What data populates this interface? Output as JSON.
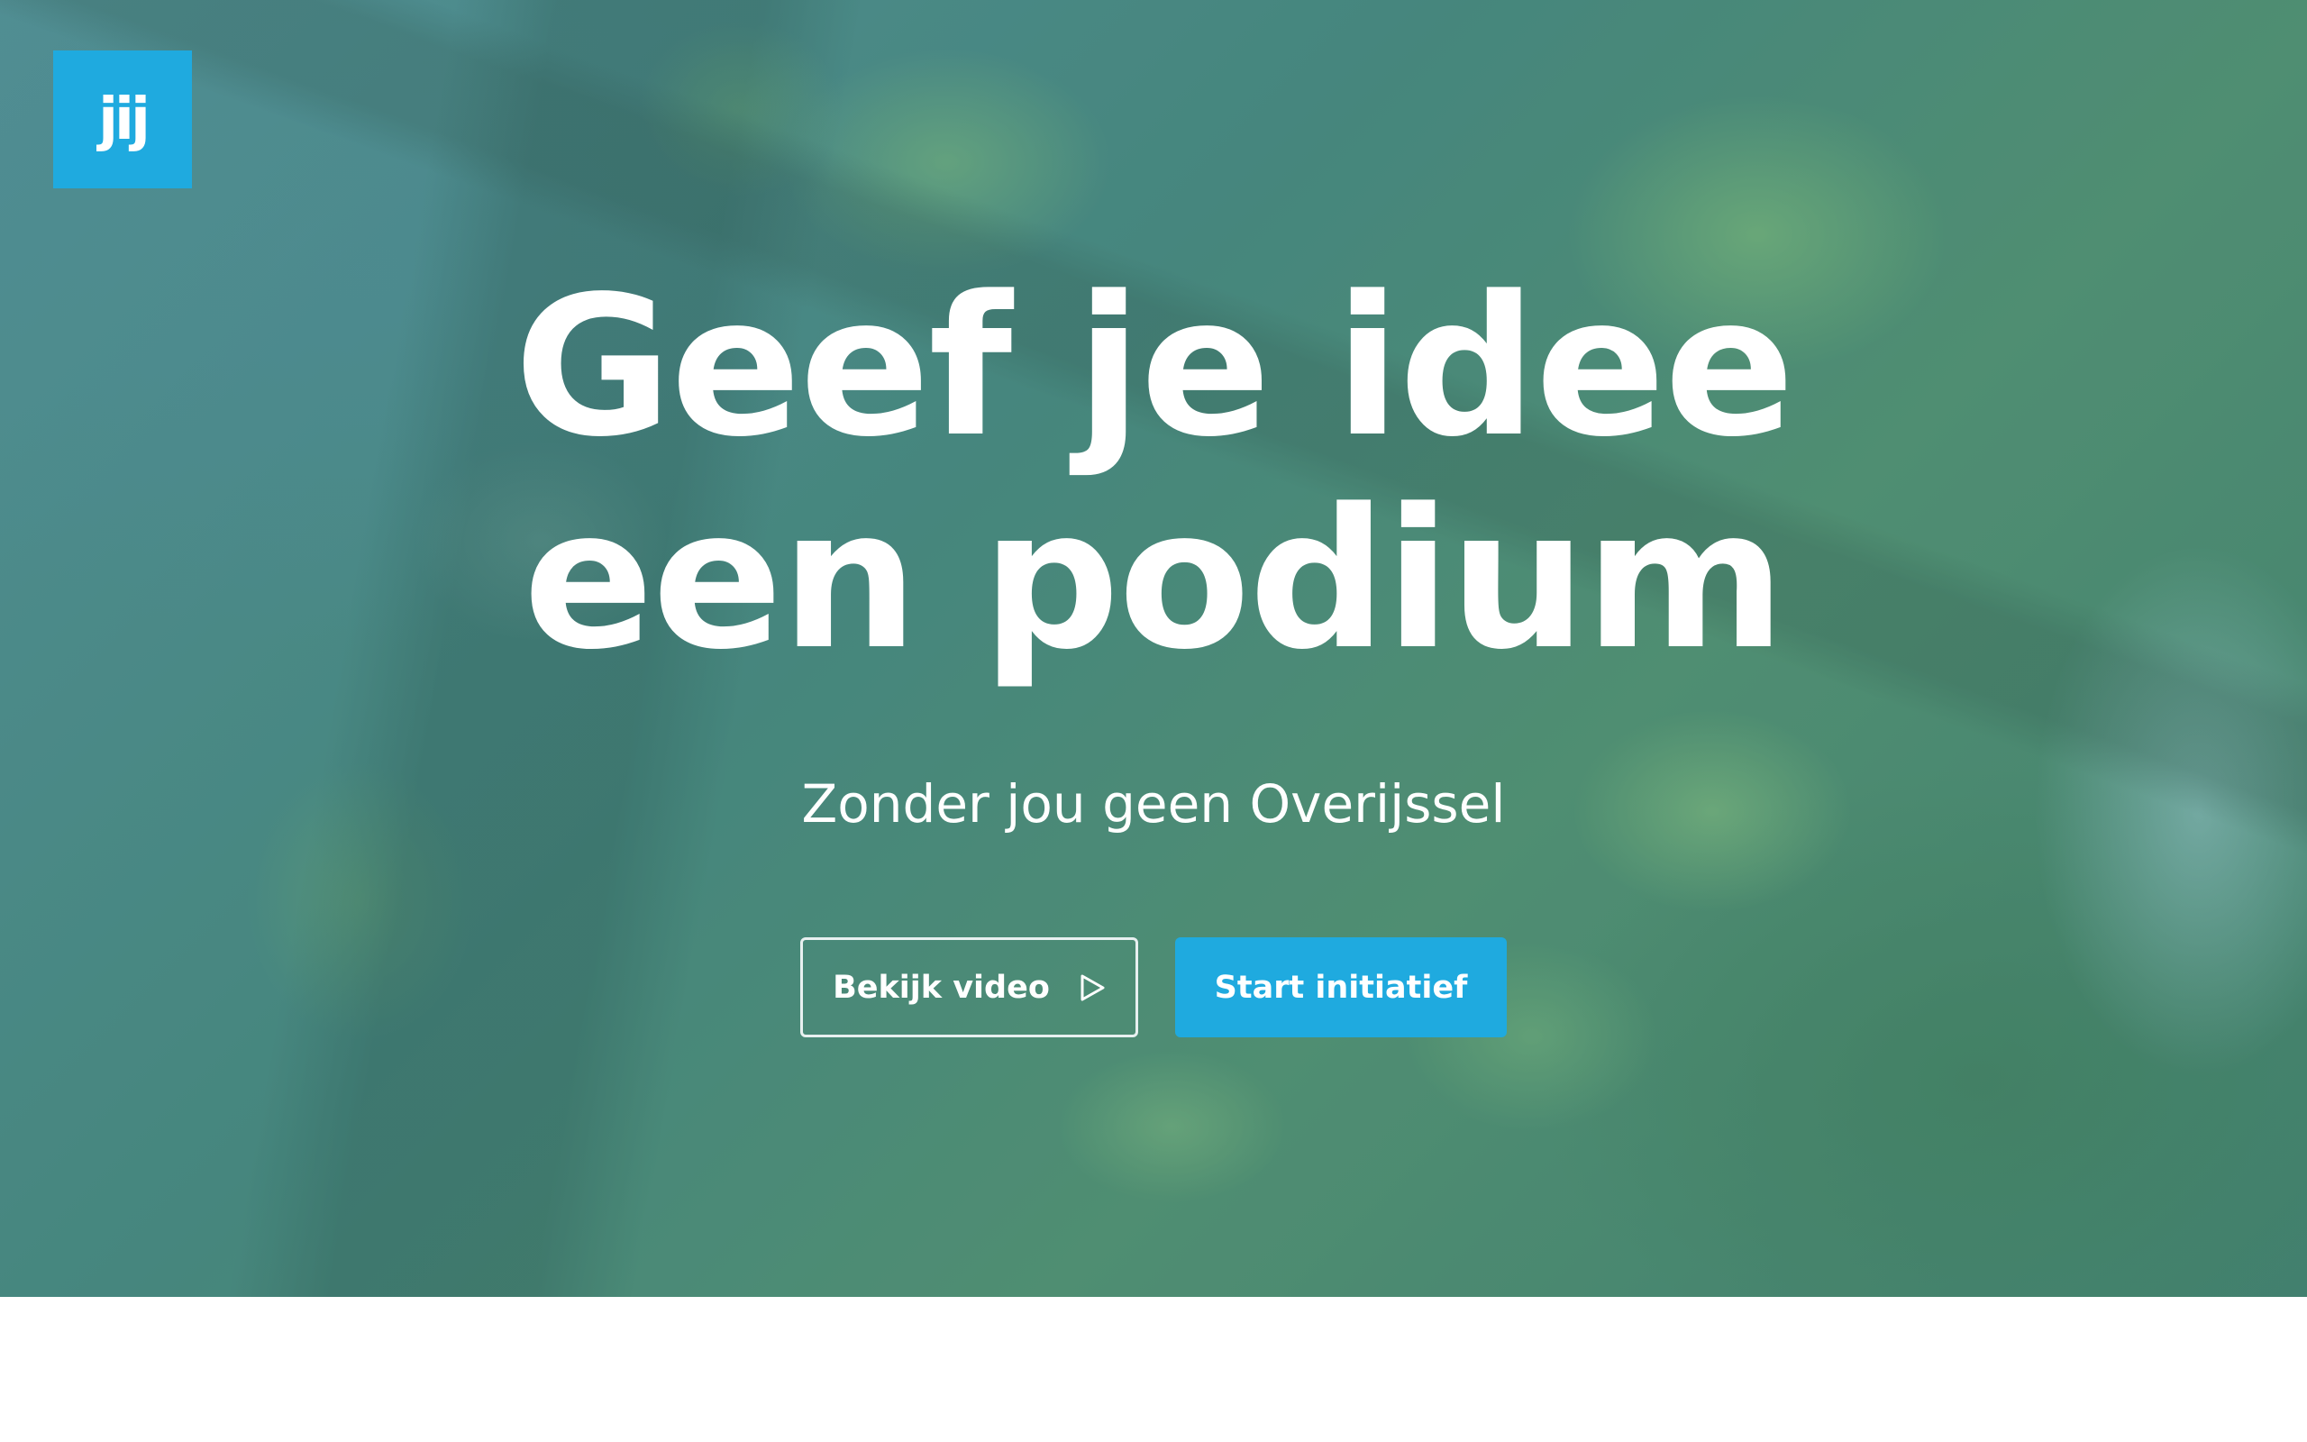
{
  "logo": {
    "text": "jij"
  },
  "hero": {
    "title_line1": "Geef je idee",
    "title_line2": "een podium",
    "subtitle": "Zonder jou geen Overijssel"
  },
  "buttons": {
    "video_label": "Bekijk video",
    "start_label": "Start initiatief"
  },
  "colors": {
    "brand_blue": "#1faadf",
    "text": "#ffffff"
  },
  "icons": {
    "play": "play-icon"
  }
}
